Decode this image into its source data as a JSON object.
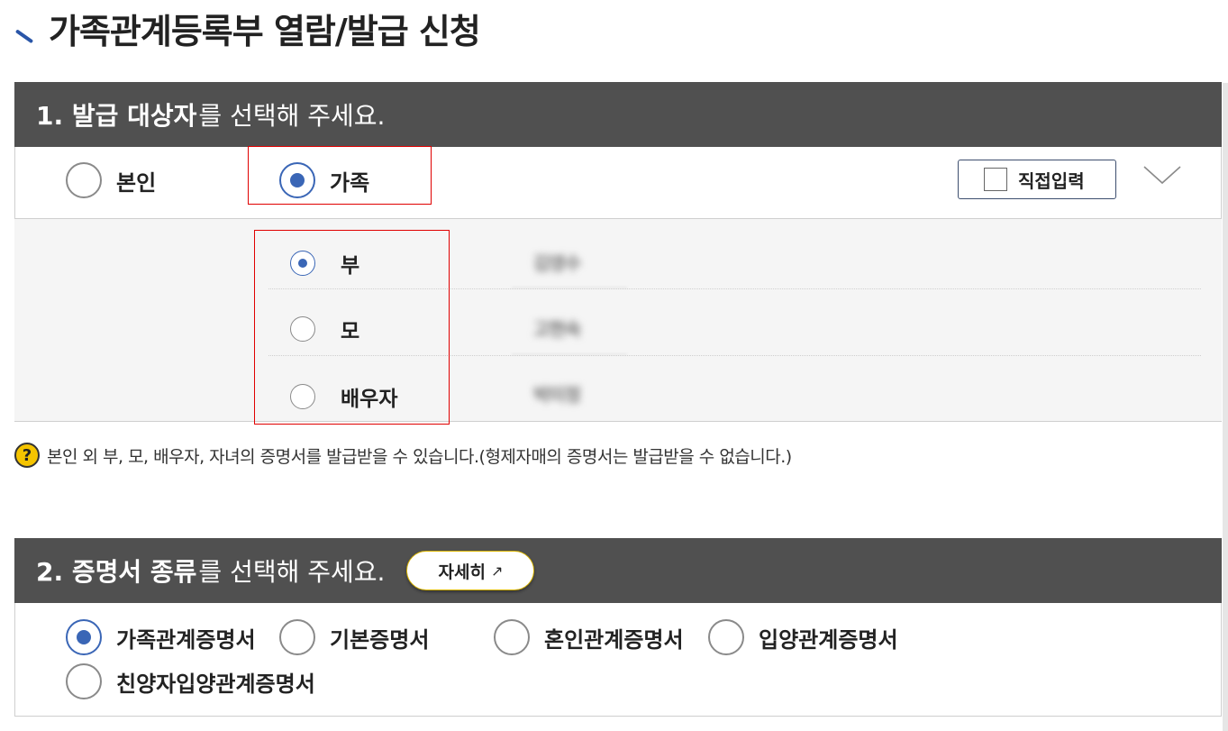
{
  "page": {
    "title": "가족관계등록부 열람/발급 신청"
  },
  "section1": {
    "header_strong": "1. 발급 대상자",
    "header_normal": "를 선택해 주세요.",
    "options": [
      {
        "label": "본인",
        "checked": false
      },
      {
        "label": "가족",
        "checked": true
      }
    ],
    "direct_input_label": "직접입력",
    "family_members": [
      {
        "label": "부",
        "name": "김영수",
        "checked": true
      },
      {
        "label": "모",
        "name": "고현숙",
        "checked": false
      },
      {
        "label": "배우자",
        "name": "박미정",
        "checked": false
      }
    ]
  },
  "help": {
    "icon": "?",
    "text": "본인 외 부, 모, 배우자, 자녀의 증명서를 발급받을 수 있습니다.(형제자매의 증명서는 발급받을 수 없습니다.)"
  },
  "section2": {
    "header_strong": "2. 증명서 종류",
    "header_normal": "를 선택해 주세요.",
    "detail_button_label": "자세히",
    "certificates": [
      {
        "label": "가족관계증명서",
        "checked": true
      },
      {
        "label": "기본증명서",
        "checked": false
      },
      {
        "label": "혼인관계증명서",
        "checked": false
      },
      {
        "label": "입양관계증명서",
        "checked": false
      },
      {
        "label": "친양자입양관계증명서",
        "checked": false
      }
    ]
  },
  "colors": {
    "header_bg": "#505050",
    "accent_blue": "#3a66b6",
    "highlight_red": "#e00000",
    "detail_border": "#d9b400"
  }
}
